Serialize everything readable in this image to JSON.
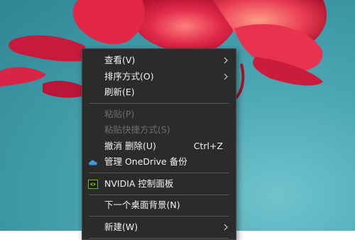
{
  "context_menu": {
    "items": [
      {
        "label": "查看(V)"
      },
      {
        "label": "排序方式(O)"
      },
      {
        "label": "刷新(E)"
      },
      {
        "label": "粘贴(P)"
      },
      {
        "label": "粘贴快捷方式(S)"
      },
      {
        "label": "撤消 删除(U)",
        "shortcut": "Ctrl+Z"
      },
      {
        "label": "管理 OneDrive 备份",
        "icon": "onedrive-cloud-icon"
      },
      {
        "label": "NVIDIA 控制面板",
        "icon": "nvidia-icon"
      },
      {
        "label": "下一个桌面背景(N)"
      },
      {
        "label": "新建(W)"
      }
    ]
  },
  "colors": {
    "menu_background": "#2b2b2b",
    "menu_text": "#f2f2f2",
    "menu_disabled_text": "#6d6d6d",
    "desktop_teal": "#4ba6b3",
    "flower_red": "#d81e3c",
    "onedrive_blue": "#3a9ae8",
    "nvidia_green": "#76b900"
  }
}
